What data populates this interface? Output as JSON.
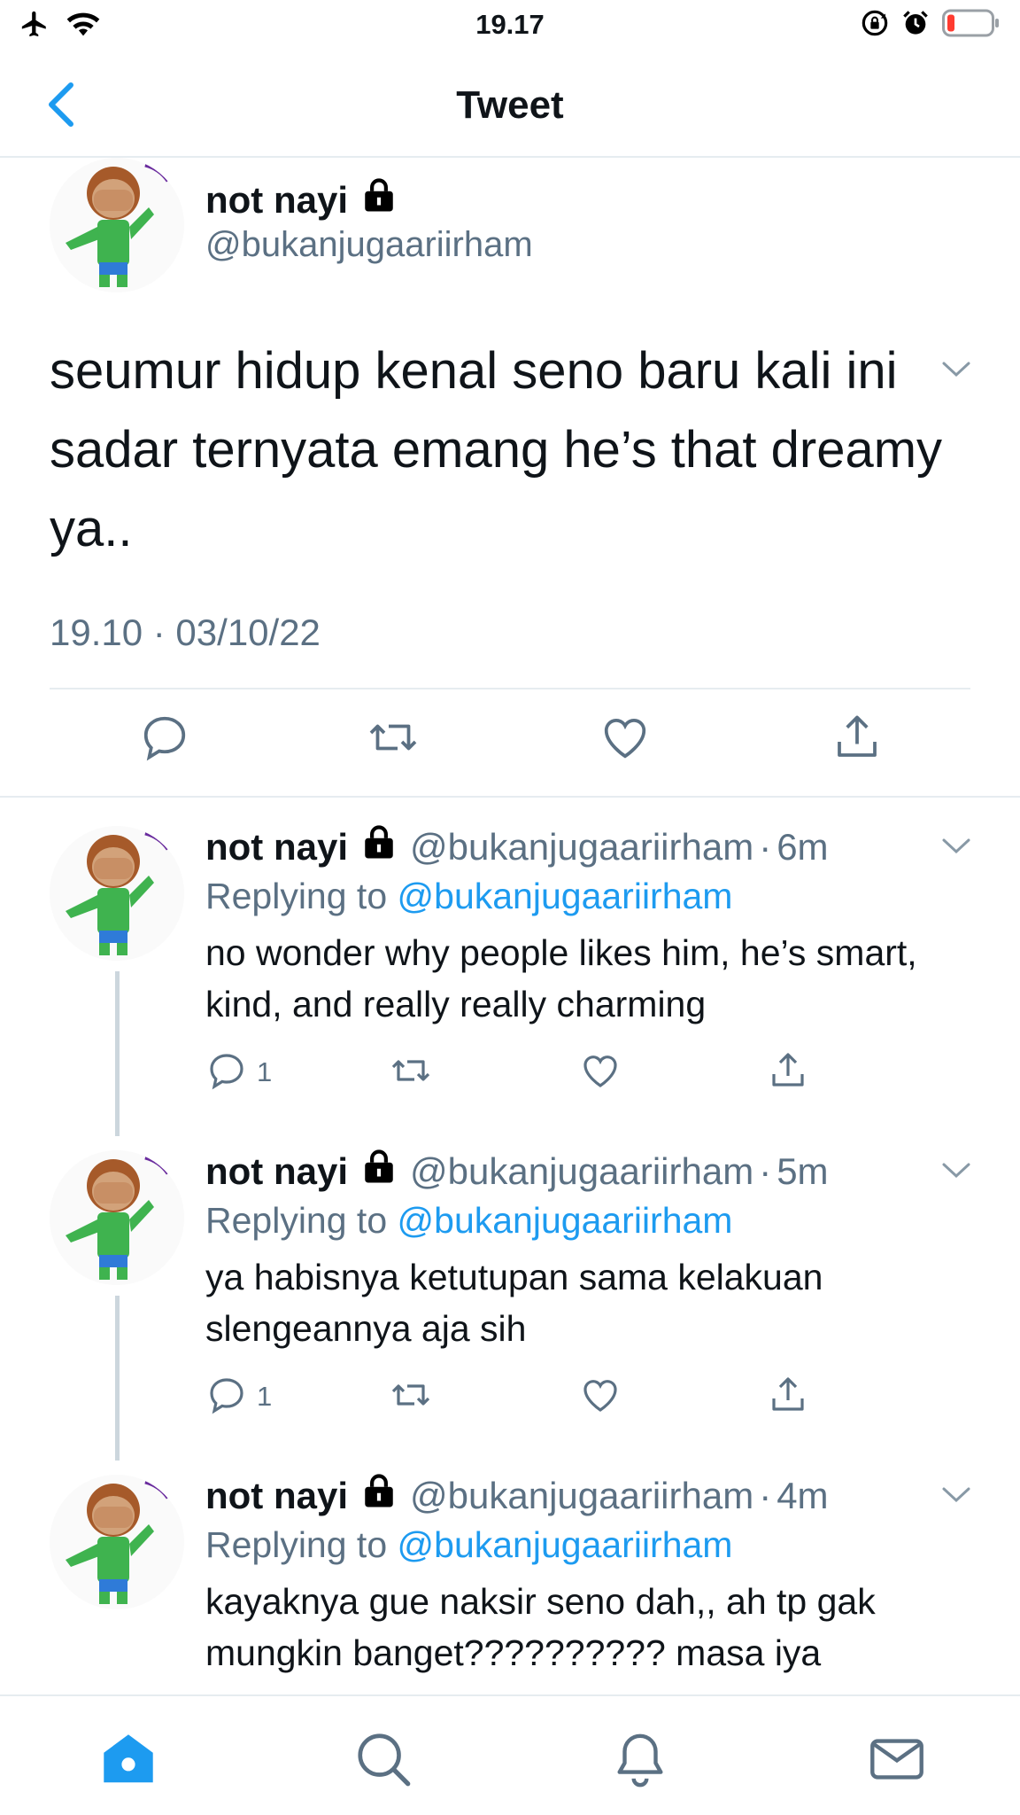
{
  "status_bar": {
    "time": "19.17"
  },
  "nav": {
    "title": "Tweet"
  },
  "main_tweet": {
    "name": "not nayi",
    "handle": "@bukanjugaariirham",
    "text": "seumur hidup kenal seno baru kali ini sadar ternyata emang he’s that dreamy ya..",
    "timestamp": "19.10 · 03/10/22"
  },
  "replies": [
    {
      "name": "not nayi",
      "handle": "@bukanjugaariirham",
      "dot": "·",
      "time": "6m",
      "replying_prefix": "Replying to",
      "replying_handle": "@bukanjugaariirham",
      "text": "no wonder why people likes him, he’s smart, kind, and really really charming",
      "reply_count": "1"
    },
    {
      "name": "not nayi",
      "handle": "@bukanjugaariirham",
      "dot": "·",
      "time": "5m",
      "replying_prefix": "Replying to",
      "replying_handle": "@bukanjugaariirham",
      "text": "ya habisnya ketutupan sama kelakuan slengeannya aja sih",
      "reply_count": "1"
    },
    {
      "name": "not nayi",
      "handle": "@bukanjugaariirham",
      "dot": "·",
      "time": "4m",
      "replying_prefix": "Replying to",
      "replying_handle": "@bukanjugaariirham",
      "text": "kayaknya gue naksir seno dah,, ah tp gak mungkin banget?????????? masa iya",
      "reply_count": ""
    }
  ],
  "colors": {
    "accent": "#1d9bf0",
    "text_primary": "#0f1419",
    "text_secondary": "#5b7083",
    "divider": "#e6ecf0",
    "battery_low": "#ff3b30"
  },
  "icons": {
    "status_left": [
      "airplane-icon",
      "wifi-icon"
    ],
    "status_right": [
      "orientation-lock-icon",
      "alarm-icon",
      "battery-icon"
    ],
    "tweet_actions": [
      "reply-icon",
      "retweet-icon",
      "like-icon",
      "share-icon"
    ],
    "tabs": [
      "home-icon",
      "search-icon",
      "notifications-icon",
      "messages-icon"
    ]
  }
}
